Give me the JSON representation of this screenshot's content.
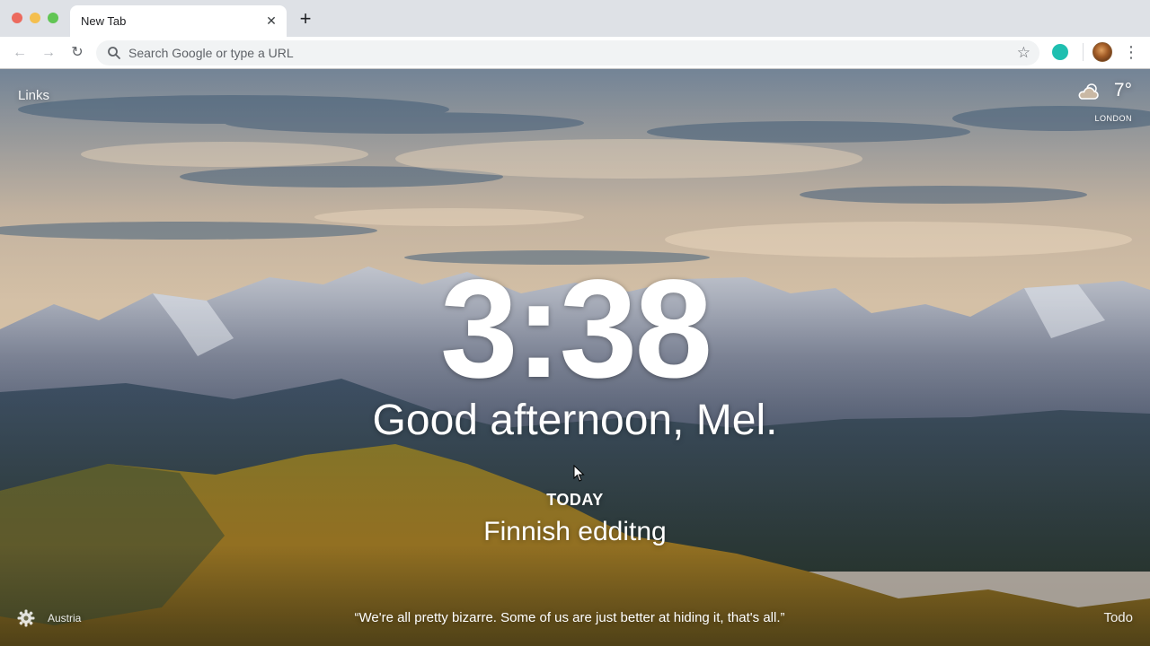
{
  "browser": {
    "tab_title": "New Tab",
    "tab_close": "✕",
    "new_tab": "+",
    "omnibox_placeholder": "Search Google or type a URL",
    "nav": {
      "back": "←",
      "forward": "→",
      "reload": "↻"
    },
    "star": "☆",
    "menu": "⋮",
    "icons": [
      "search-icon",
      "bookmark-star-icon",
      "extension-icon",
      "profile-avatar",
      "menu-dots-icon"
    ]
  },
  "page": {
    "links_label": "Links",
    "weather": {
      "temperature": "7°",
      "city": "LONDON",
      "icon": "partly-cloudy-icon"
    },
    "clock": "3:38",
    "greeting": "Good afternoon, Mel.",
    "focus": {
      "label": "TODAY",
      "text": "Finnish edditng"
    },
    "location": "Austria",
    "quote": "“We're all pretty bizarre. Some of us are just better at hiding it, that's all.”",
    "todo_label": "Todo"
  },
  "colors": {
    "tab_strip": "#dee1e6",
    "toolbar": "#ffffff",
    "omnibox": "#f1f3f4",
    "extension": "#1fbfb0",
    "sky": "#c9b8a4",
    "forest": "#b58a2a"
  }
}
